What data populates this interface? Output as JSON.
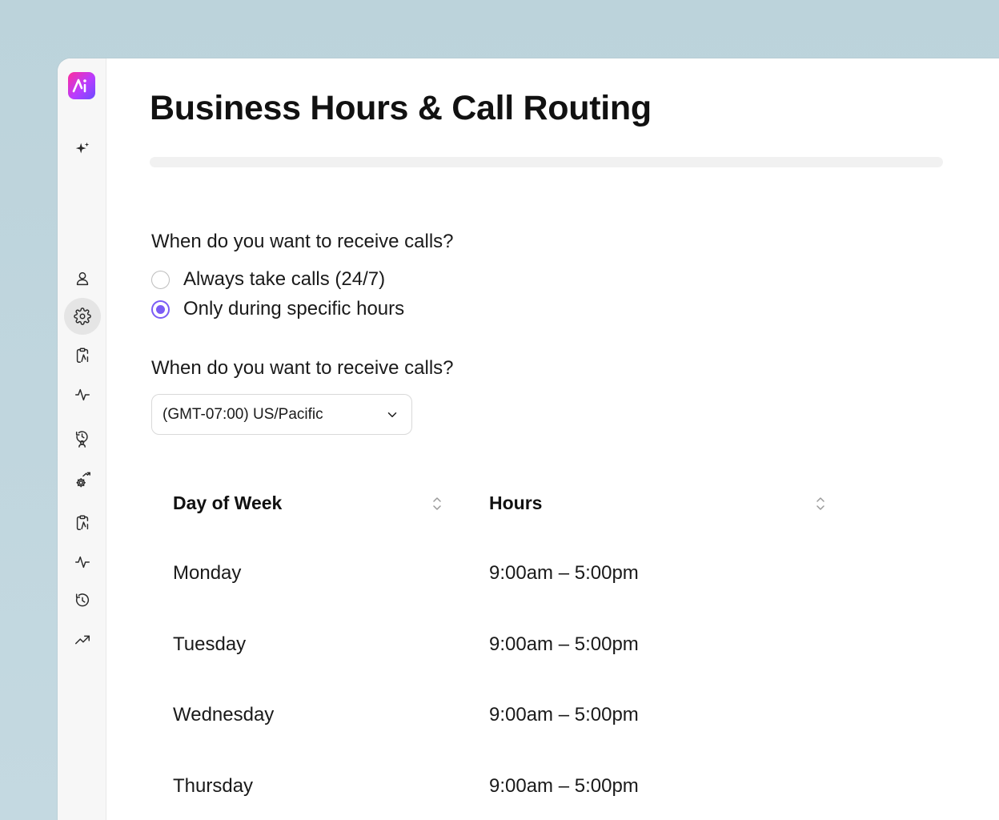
{
  "page": {
    "title": "Business Hours & Call Routing",
    "progress_fraction": 0.0
  },
  "colors": {
    "accent": "#7b5cf5",
    "background": "#bcd3db",
    "sidebar": "#f7f7f7"
  },
  "sidebar": {
    "logo_icon": "app-logo",
    "items": [
      {
        "icon": "sparkles-icon",
        "active": false
      },
      {
        "icon": "user-icon",
        "active": false
      },
      {
        "icon": "gear-icon",
        "active": true
      },
      {
        "icon": "clipboard-icon",
        "active": false
      },
      {
        "icon": "activity-icon",
        "active": false
      },
      {
        "icon": "history-user-icon",
        "active": false
      },
      {
        "icon": "gear-trend-icon",
        "active": false
      },
      {
        "icon": "clipboard-icon",
        "active": false
      },
      {
        "icon": "activity-icon",
        "active": false
      },
      {
        "icon": "history-icon",
        "active": false
      },
      {
        "icon": "trend-up-icon",
        "active": false
      }
    ]
  },
  "call_mode": {
    "question": "When do you want to receive calls?",
    "options": [
      {
        "label": "Always take calls (24/7)",
        "selected": false
      },
      {
        "label": "Only during specific hours",
        "selected": true
      }
    ]
  },
  "timezone": {
    "question": "When do you want to receive calls?",
    "selected": "(GMT-07:00) US/Pacific",
    "icon": "chevron-down-icon"
  },
  "schedule": {
    "columns": [
      "Day of Week",
      "Hours"
    ],
    "rows": [
      {
        "day": "Monday",
        "hours": "9:00am – 5:00pm"
      },
      {
        "day": "Tuesday",
        "hours": "9:00am – 5:00pm"
      },
      {
        "day": "Wednesday",
        "hours": "9:00am – 5:00pm"
      },
      {
        "day": "Thursday",
        "hours": "9:00am – 5:00pm"
      }
    ]
  }
}
